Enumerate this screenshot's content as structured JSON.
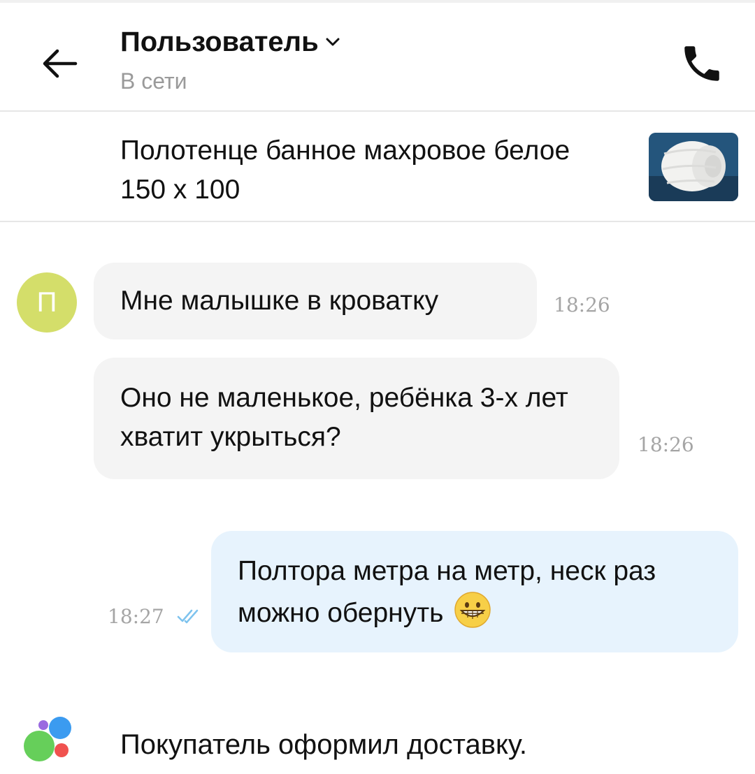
{
  "header": {
    "title": "Пользователь",
    "status": "В сети"
  },
  "item": {
    "title": "Полотенце банное махровое белое 150 х 100"
  },
  "messages": [
    {
      "author_initial": "П",
      "text": "Мне малышке в кроватку",
      "time": "18:26",
      "direction": "in"
    },
    {
      "text": "Оно не маленькое, ребёнка 3-х лет хватит укрыться?",
      "time": "18:26",
      "direction": "in"
    },
    {
      "text": "Полтора метра на метр, неск раз можно обернуть",
      "time": "18:27",
      "direction": "out",
      "read": true,
      "emoji": "grinning-face"
    }
  ],
  "system": {
    "text": "Покупатель оформил доставку."
  },
  "icons": {
    "back": "arrow-left-icon",
    "dropdown": "chevron-down-icon",
    "call": "phone-icon",
    "read_receipt": "double-check-icon",
    "system": "marketplace-logo-icon"
  },
  "colors": {
    "avatar": "#d4de6a",
    "incoming_bubble": "#f4f4f4",
    "outgoing_bubble": "#e7f3fd",
    "check_marks": "#7ec3ee"
  }
}
